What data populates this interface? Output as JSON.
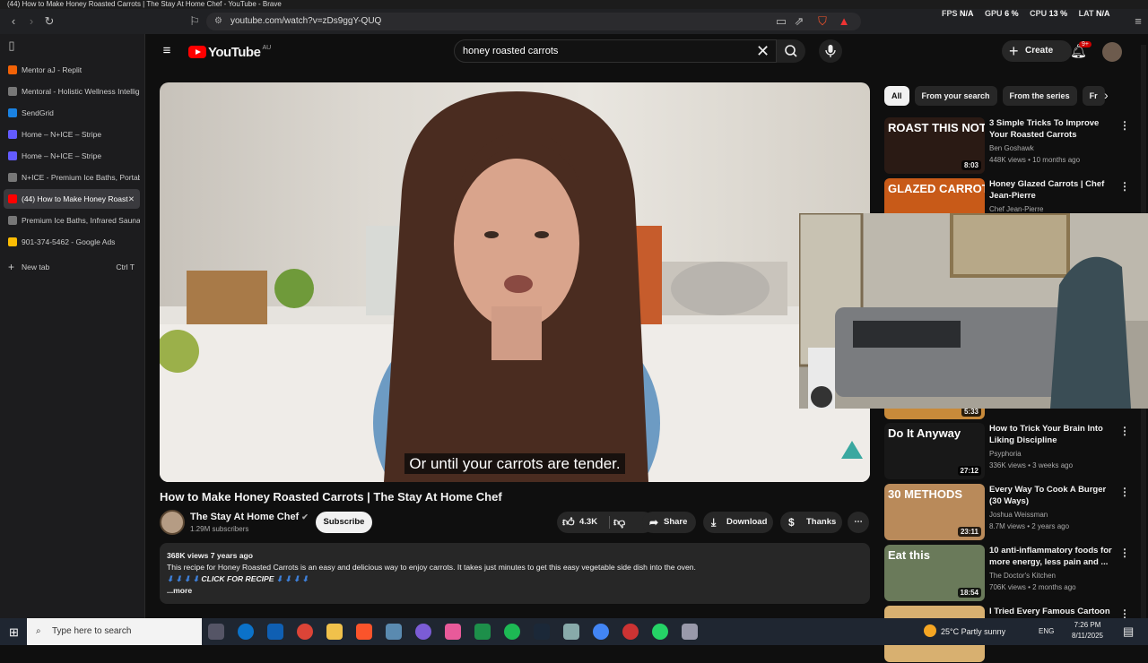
{
  "window": {
    "title": "(44) How to Make Honey Roasted Carrots | The Stay At Home Chef - YouTube - Brave"
  },
  "browser": {
    "url": "youtube.com/watch?v=zDs9ggY-QUQ",
    "badge_count": "1"
  },
  "overlay": {
    "fps_label": "FPS",
    "fps_value": "N/A",
    "gpu_label": "GPU",
    "gpu_value": "6 %",
    "cpu_label": "CPU",
    "cpu_value": "13 %",
    "lat_label": "LAT",
    "lat_value": "N/A"
  },
  "sidebar": {
    "tabs": [
      {
        "label": "Mentor aJ - Replit",
        "color": "#f26207"
      },
      {
        "label": "Mentoral - Holistic Wellness Intellig",
        "color": "#777777"
      },
      {
        "label": "SendGrid",
        "color": "#1a82e2"
      },
      {
        "label": "Home – N+ICE – Stripe",
        "color": "#635bff"
      },
      {
        "label": "Home – N+ICE – Stripe",
        "color": "#635bff"
      },
      {
        "label": "N+ICE - Premium Ice Baths, Portab",
        "color": "#777777"
      },
      {
        "label": "(44) How to Make Honey Roast",
        "color": "#ff0000"
      },
      {
        "label": "Premium Ice Baths, Infrared Sauna",
        "color": "#777777"
      },
      {
        "label": "901-374-5462 - Google Ads",
        "color": "#fbbc04"
      }
    ],
    "new_tab": "New tab",
    "new_tab_shortcut": "Ctrl T"
  },
  "youtube": {
    "logo": "YouTube",
    "region": "AU",
    "search_value": "honey roasted carrots",
    "create": "Create",
    "notifications": "9+",
    "caption": "Or until your carrots are tender.",
    "video_title": "How to Make Honey Roasted Carrots | The Stay At Home Chef",
    "channel": "The Stay At Home Chef",
    "subscribers": "1.29M subscribers",
    "subscribe": "Subscribe",
    "likes": "4.3K",
    "share": "Share",
    "download": "Download",
    "thanks": "Thanks",
    "desc_meta": "368K views  7 years ago",
    "desc_text": "This recipe for Honey Roasted Carrots is an easy and delicious way to enjoy carrots. It takes just minutes to get this easy vegetable side dish into the oven.",
    "desc_line2": "CLICK FOR RECIPE",
    "more": "...more",
    "chips": [
      "All",
      "From your search",
      "From the series",
      "Fr"
    ],
    "recs": [
      {
        "title": "3 Simple Tricks To Improve Your Roasted Carrots",
        "channel": "Ben Goshawk",
        "meta": "448K views • 10 months ago",
        "dur": "8:03",
        "thumb_bg": "#2a1a14",
        "thumb_text": "ROAST THIS   NOT THIS"
      },
      {
        "title": "Honey Glazed Carrots | Chef Jean-Pierre",
        "channel": "Chef Jean-Pierre",
        "meta": "",
        "dur": "",
        "thumb_bg": "#c85a18",
        "thumb_text": "GLAZED CARROTS"
      },
      {
        "title": "How to Trick Your Brain Into Liking Discipline",
        "channel": "Psyphoria",
        "meta": "336K views • 3 weeks ago",
        "dur": "27:12",
        "thumb_bg": "#181818",
        "thumb_text": "Do It Anyway"
      },
      {
        "title": "Every Way To Cook A Burger (30 Ways)",
        "channel": "Joshua Weissman",
        "meta": "8.7M views • 2 years ago",
        "dur": "23:11",
        "thumb_bg": "#b98a5a",
        "thumb_text": "30 METHODS"
      },
      {
        "title": "10 anti-inflammatory foods for more energy, less pain and ...",
        "channel": "The Doctor's Kitchen",
        "meta": "706K views • 2 months ago",
        "dur": "18:54",
        "thumb_bg": "#6a7a5a",
        "thumb_text": "Eat this"
      },
      {
        "title": "I Tried Every Famous Cartoon",
        "channel": "",
        "meta": "",
        "dur": "",
        "thumb_bg": "#d8b070",
        "thumb_text": ""
      }
    ],
    "partial_dur": "5:33"
  },
  "taskbar": {
    "search_placeholder": "Type here to search",
    "weather": "25°C  Partly sunny",
    "lang": "ENG",
    "time": "7:26 PM",
    "date": "8/11/2025"
  }
}
